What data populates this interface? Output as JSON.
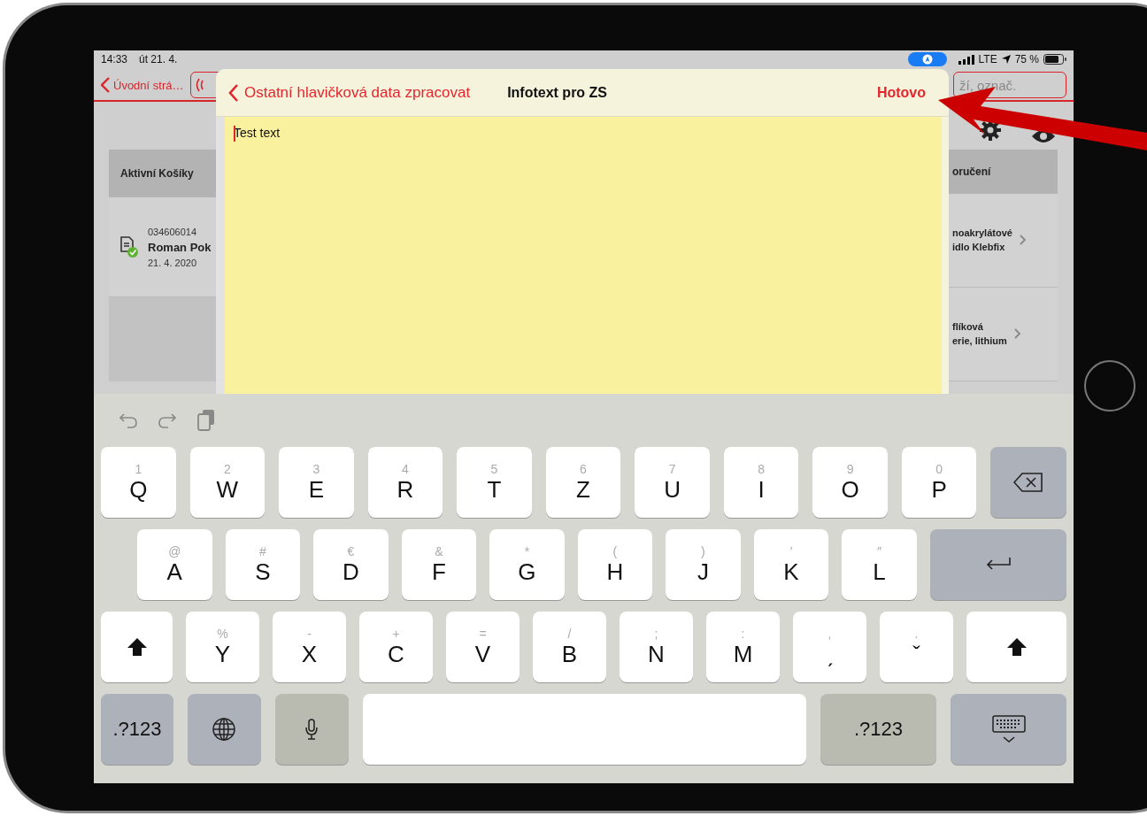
{
  "status_bar": {
    "time": "14:33",
    "date": "út 21. 4.",
    "network": "LTE",
    "battery": "75 %"
  },
  "app": {
    "back": "Úvodní strá…",
    "search": {
      "placeholder": "ží, označ."
    },
    "left_panel": {
      "header": "Aktivní Košíky",
      "rows": [
        {
          "number": "034606014",
          "name": "Roman Pok",
          "date": "21. 4. 2020"
        }
      ]
    },
    "right_panel": {
      "header": "oručení",
      "rows": [
        {
          "line_1": "noakrylátové",
          "line_2": "idlo Klebfix"
        },
        {
          "line_1": "flíková",
          "line_2": "erie, lithium"
        }
      ]
    }
  },
  "dialog": {
    "back": "Ostatní hlavičková data zpracovat",
    "title": "Infotext pro ZS",
    "done": "Hotovo",
    "text": "Test text"
  },
  "keyboard": {
    "rows": [
      [
        {
          "kind": "letter",
          "label": "Q",
          "hint": "1"
        },
        {
          "kind": "letter",
          "label": "W",
          "hint": "2"
        },
        {
          "kind": "letter",
          "label": "E",
          "hint": "3"
        },
        {
          "kind": "letter",
          "label": "R",
          "hint": "4"
        },
        {
          "kind": "letter",
          "label": "T",
          "hint": "5"
        },
        {
          "kind": "letter",
          "label": "Z",
          "hint": "6"
        },
        {
          "kind": "letter",
          "label": "U",
          "hint": "7"
        },
        {
          "kind": "letter",
          "label": "I",
          "hint": "8"
        },
        {
          "kind": "letter",
          "label": "O",
          "hint": "9"
        },
        {
          "kind": "letter",
          "label": "P",
          "hint": "0"
        },
        {
          "kind": "backspace"
        }
      ],
      [
        {
          "kind": "letter",
          "label": "A",
          "hint": "@"
        },
        {
          "kind": "letter",
          "label": "S",
          "hint": "#"
        },
        {
          "kind": "letter",
          "label": "D",
          "hint": "€"
        },
        {
          "kind": "letter",
          "label": "F",
          "hint": "&"
        },
        {
          "kind": "letter",
          "label": "G",
          "hint": "*"
        },
        {
          "kind": "letter",
          "label": "H",
          "hint": "("
        },
        {
          "kind": "letter",
          "label": "J",
          "hint": ")"
        },
        {
          "kind": "letter",
          "label": "K",
          "hint": "′"
        },
        {
          "kind": "letter",
          "label": "L",
          "hint": "″"
        },
        {
          "kind": "return"
        }
      ],
      [
        {
          "kind": "shift"
        },
        {
          "kind": "letter",
          "label": "Y",
          "hint": "%"
        },
        {
          "kind": "letter",
          "label": "X",
          "hint": "-"
        },
        {
          "kind": "letter",
          "label": "C",
          "hint": "+"
        },
        {
          "kind": "letter",
          "label": "V",
          "hint": "="
        },
        {
          "kind": "letter",
          "label": "B",
          "hint": "/"
        },
        {
          "kind": "letter",
          "label": "N",
          "hint": ";"
        },
        {
          "kind": "letter",
          "label": "M",
          "hint": ":"
        },
        {
          "kind": "letter",
          "label": "ˏ",
          "hint": ","
        },
        {
          "kind": "letter",
          "label": "ˇ",
          "hint": "."
        },
        {
          "kind": "shift"
        }
      ],
      [
        {
          "kind": "mode",
          "label": ".?123"
        },
        {
          "kind": "globe"
        },
        {
          "kind": "mic"
        },
        {
          "kind": "space"
        },
        {
          "kind": "mode-wide",
          "label": ".?123"
        },
        {
          "kind": "hide"
        }
      ]
    ]
  }
}
